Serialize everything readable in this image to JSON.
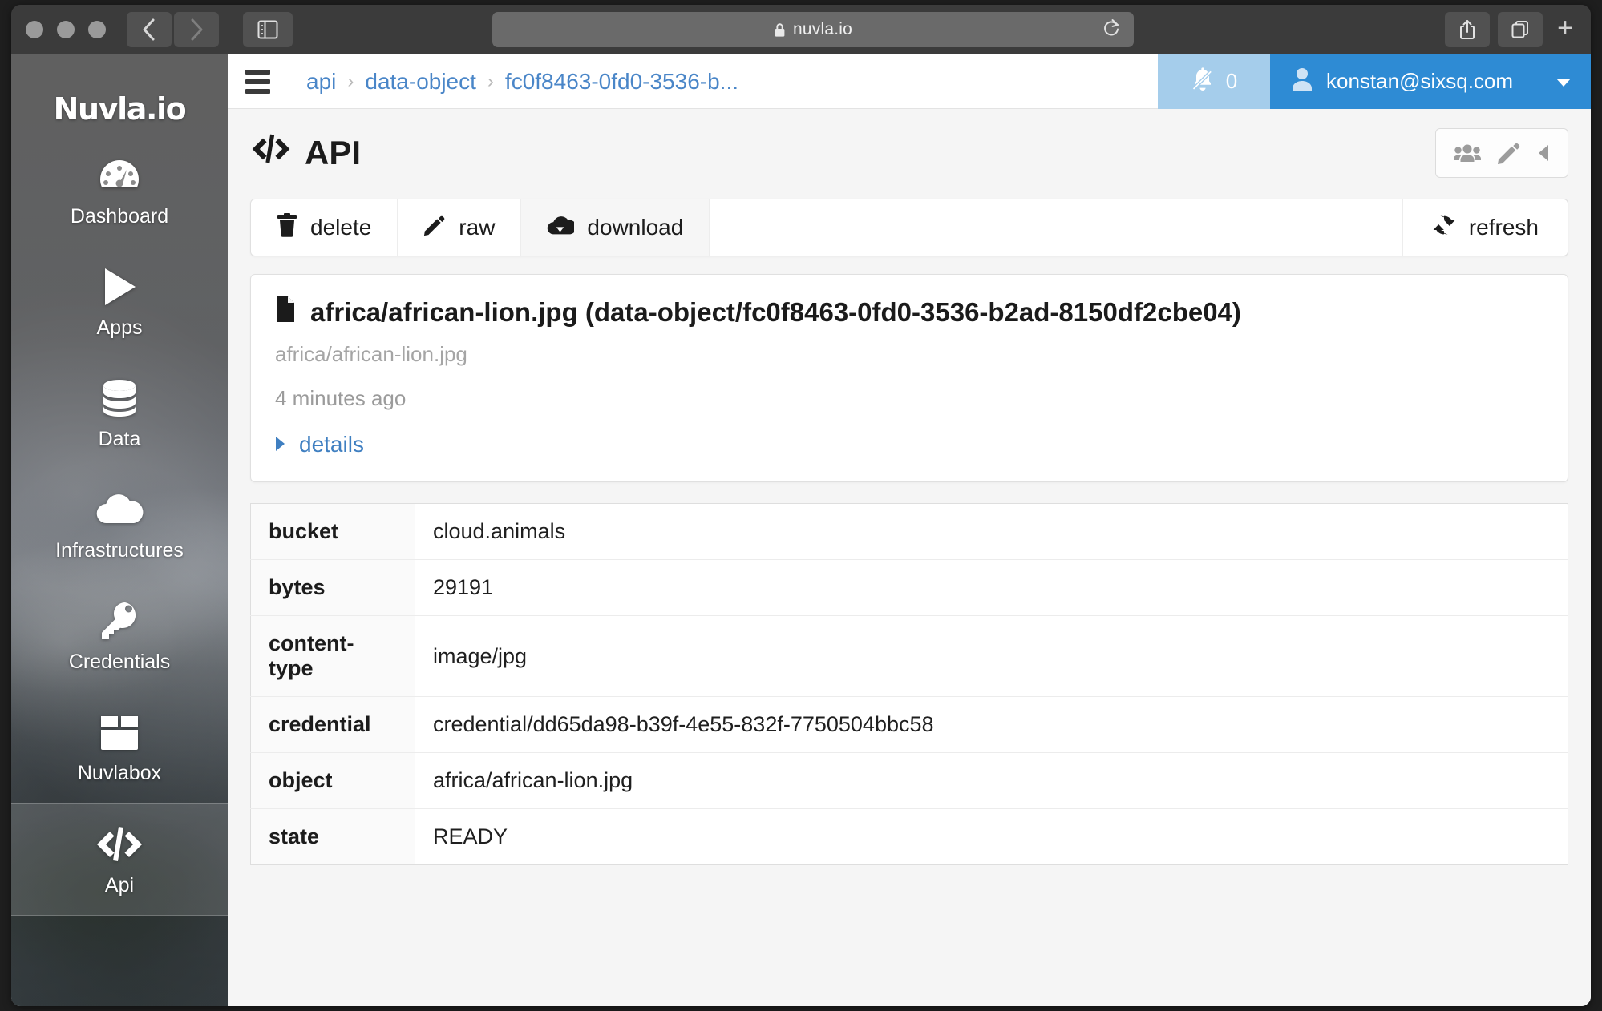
{
  "browser": {
    "url": "nuvla.io",
    "lock_icon": "lock-icon",
    "back_icon": "chevron-left-icon",
    "forward_icon": "chevron-right-icon",
    "sidebar_icon": "sidebar-panel-icon",
    "reload_icon": "reload-icon",
    "share_icon": "share-icon",
    "tabs_icon": "tab-overview-icon",
    "new_tab_label": "+"
  },
  "sidebar": {
    "logo": "Nuvla.io",
    "items": [
      {
        "label": "Dashboard",
        "icon": "gauge-icon",
        "active": false
      },
      {
        "label": "Apps",
        "icon": "play-icon",
        "active": false
      },
      {
        "label": "Data",
        "icon": "database-icon",
        "active": false
      },
      {
        "label": "Infrastructures",
        "icon": "cloud-icon",
        "active": false
      },
      {
        "label": "Credentials",
        "icon": "key-icon",
        "active": false
      },
      {
        "label": "Nuvlabox",
        "icon": "box-icon",
        "active": false
      },
      {
        "label": "Api",
        "icon": "code-icon",
        "active": true
      }
    ]
  },
  "topbar": {
    "menu_icon": "hamburger-icon",
    "breadcrumb": [
      "api",
      "data-object",
      "fc0f8463-0fd0-3536-b..."
    ],
    "separator": "›",
    "notifications": {
      "icon": "bell-slash-icon",
      "count": "0"
    },
    "user": {
      "icon": "user-icon",
      "email": "konstan@sixsq.com",
      "caret": "caret-down-icon"
    }
  },
  "page": {
    "title": "API",
    "title_icon": "code-icon",
    "acl": {
      "share_icon": "users-icon",
      "edit_icon": "pencil-icon",
      "collapse_icon": "caret-left-icon"
    }
  },
  "actions": {
    "buttons": [
      {
        "label": "delete",
        "icon": "trash-icon",
        "active": false
      },
      {
        "label": "raw",
        "icon": "pencil-icon",
        "active": false
      },
      {
        "label": "download",
        "icon": "cloud-download-icon",
        "active": true
      }
    ],
    "refresh": {
      "label": "refresh",
      "icon": "refresh-icon"
    }
  },
  "detail": {
    "icon": "file-icon",
    "title": "africa/african-lion.jpg (data-object/fc0f8463-0fd0-3536-b2ad-8150df2cbe04)",
    "subtitle": "africa/african-lion.jpg",
    "timestamp": "4 minutes ago",
    "details_toggle": {
      "label": "details",
      "icon": "caret-right-icon"
    }
  },
  "attributes": [
    {
      "key": "bucket",
      "value": "cloud.animals"
    },
    {
      "key": "bytes",
      "value": "29191"
    },
    {
      "key": "content-type",
      "value": "image/jpg"
    },
    {
      "key": "credential",
      "value": "credential/dd65da98-b39f-4e55-832f-7750504bbc58"
    },
    {
      "key": "object",
      "value": "africa/african-lion.jpg"
    },
    {
      "key": "state",
      "value": "READY"
    }
  ],
  "colors": {
    "brand_blue": "#2e8bd4",
    "link_blue": "#4a86c8",
    "notification_blue": "#a5cdeb",
    "chrome_dark": "#3b3b3b"
  }
}
